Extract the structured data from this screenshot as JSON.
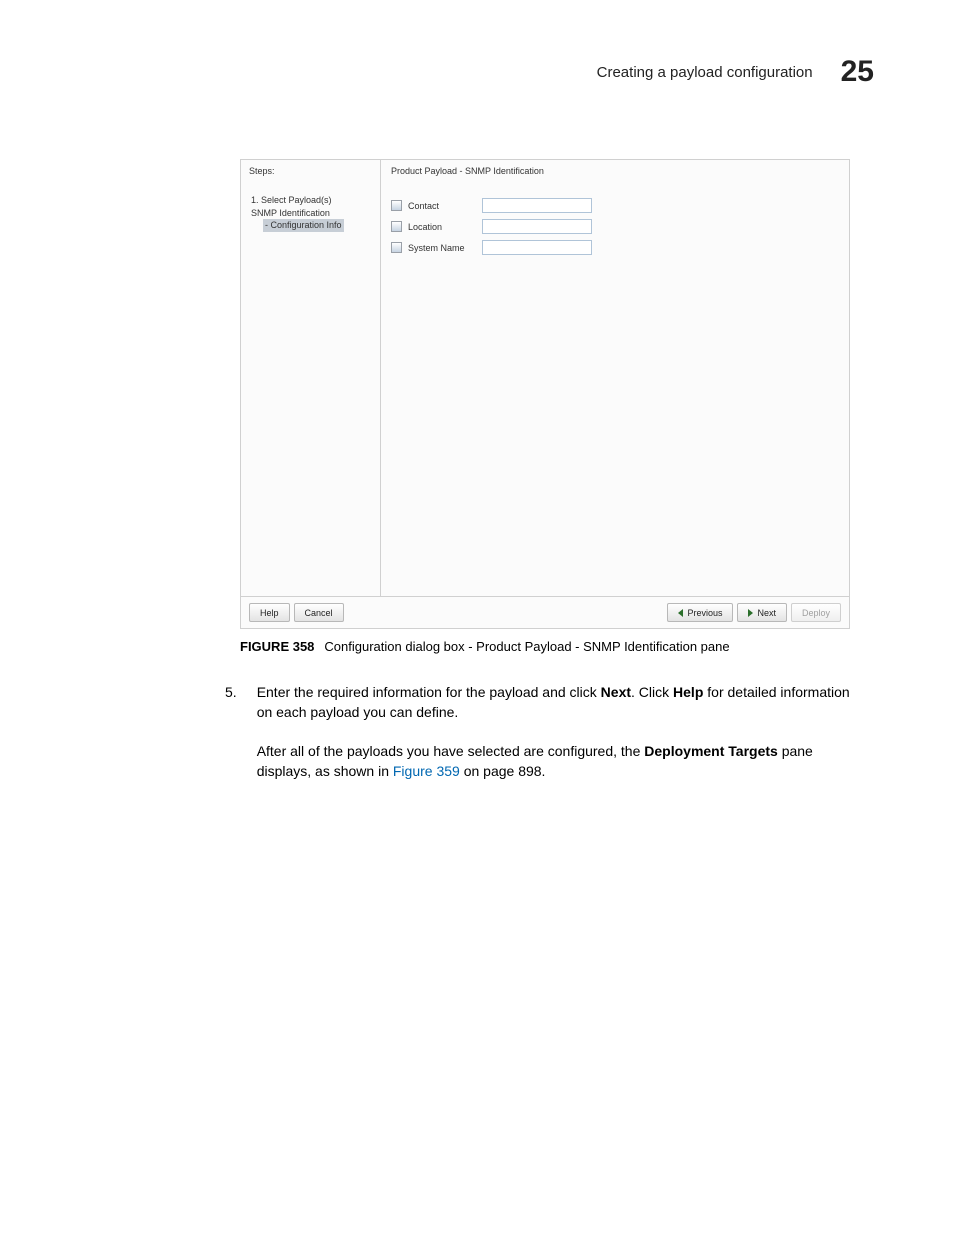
{
  "header": {
    "title": "Creating a payload configuration",
    "page_number": "25"
  },
  "dialog": {
    "steps_label": "Steps:",
    "steps": {
      "s1": "1. Select Payload(s)",
      "s2": "SNMP Identification",
      "s3": "- Configuration Info"
    },
    "pane_title": "Product Payload - SNMP Identification",
    "fields": {
      "contact": "Contact",
      "location": "Location",
      "system": "System Name"
    },
    "buttons": {
      "help": "Help",
      "cancel": "Cancel",
      "previous": "Previous",
      "next": "Next",
      "deploy": "Deploy"
    }
  },
  "caption": {
    "label": "FIGURE 358",
    "text": "Configuration dialog box - Product Payload - SNMP Identification pane"
  },
  "step5": {
    "num": "5.",
    "t1a": "Enter the required information for the payload and click ",
    "t1b": "Next",
    "t1c": ". Click ",
    "t1d": "Help",
    "t1e": " for detailed information on each payload you can define.",
    "t2a": "After all of the payloads you have selected are configured, the ",
    "t2b": "Deployment Targets",
    "t2c": " pane displays, as shown in ",
    "t2link": "Figure 359",
    "t2d": " on page 898."
  }
}
